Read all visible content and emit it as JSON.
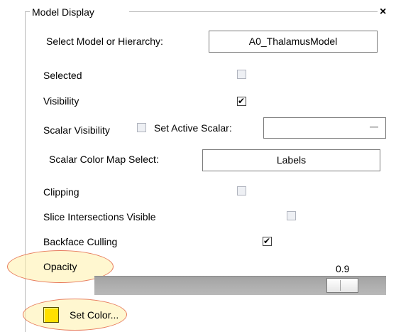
{
  "panel": {
    "title": "Model Display",
    "close_glyph": "×",
    "close_icon": "close-icon"
  },
  "model_select": {
    "label": "Select Model or Hierarchy:",
    "value": "A0_ThalamusModel"
  },
  "selected": {
    "label": "Selected",
    "checked": false
  },
  "visibility": {
    "label": "Visibility",
    "checked": true
  },
  "scalar_visibility": {
    "label": "Scalar Visibility",
    "checked": false
  },
  "active_scalar": {
    "label": "Set Active Scalar:",
    "value": ""
  },
  "color_map": {
    "label": "Scalar Color Map Select:",
    "value": "Labels"
  },
  "clipping": {
    "label": "Clipping",
    "checked": false
  },
  "slice_intersections": {
    "label": "Slice Intersections Visible",
    "checked": false
  },
  "backface_culling": {
    "label": "Backface Culling",
    "checked": true
  },
  "opacity": {
    "label": "Opacity",
    "value": "0.9",
    "fraction": 0.9
  },
  "set_color": {
    "label": "Set Color...",
    "swatch_color": "#ffe000"
  },
  "colors": {
    "highlight_fill": "#fff0aa",
    "highlight_border": "#e77b5c"
  }
}
